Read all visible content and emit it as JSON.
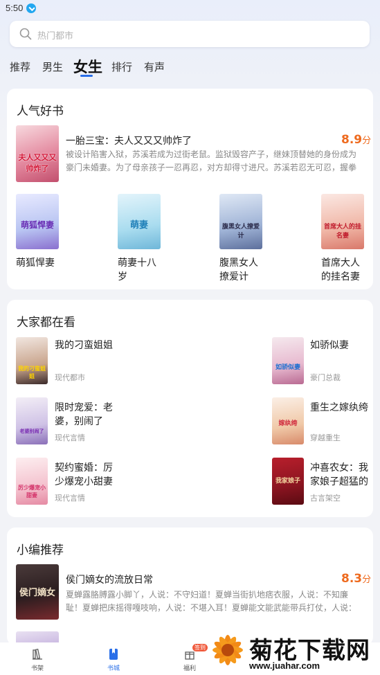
{
  "status_bar": {
    "time": "5:50"
  },
  "search": {
    "placeholder": "热门都市"
  },
  "tabs": [
    {
      "label": "推荐"
    },
    {
      "label": "男生"
    },
    {
      "label": "女生",
      "active": true
    },
    {
      "label": "排行"
    },
    {
      "label": "有声"
    }
  ],
  "popular": {
    "title": "人气好书",
    "featured": {
      "name": "一胎三宝：夫人又又又帅炸了",
      "score": "8.9",
      "score_unit": "分",
      "desc": "被设计陷害入狱，苏溪若成为过街老鼠。监狱毁容产子，继妹顶替她的身份成为豪门未婚妻。为了母亲孩子一忍再忍，对方却得寸进尺。苏溪若忍无可忍，握拳发誓，再忍她就…",
      "cover_text": "夫人又又又帅炸了"
    },
    "books": [
      {
        "name": "萌狐悍妻",
        "cover_text": "萌狐悍妻"
      },
      {
        "name": "萌妻十八岁",
        "cover_text": "萌妻"
      },
      {
        "name": "腹黑女人撩爱计",
        "cover_text": "腹黑女人撩爱计"
      },
      {
        "name": "首席大人的挂名妻",
        "cover_text": "首席大人的挂名妻"
      }
    ]
  },
  "everyone": {
    "title": "大家都在看",
    "books": [
      {
        "name": "我的刁蛮姐姐",
        "tag": "现代都市",
        "cover_text": "我的刁蛮姐姐"
      },
      {
        "name": "如骄似妻",
        "tag": "豪门总裁",
        "cover_text": "如骄似妻"
      },
      {
        "name": "限时宠爱：老婆，别闹了",
        "tag": "现代言情",
        "cover_text": "老婆别闹了"
      },
      {
        "name": "重生之嫁纨绔",
        "tag": "穿越重生",
        "cover_text": "嫁纨绔"
      },
      {
        "name": "契约蜜婚：厉少爆宠小甜妻",
        "tag": "现代言情",
        "cover_text": "厉少爆宠小甜妻"
      },
      {
        "name": "冲喜农女：我家娘子超猛的",
        "tag": "古言架空",
        "cover_text": "我家娘子"
      }
    ]
  },
  "editor": {
    "title": "小编推荐",
    "featured": {
      "name": "侯门嫡女的流放日常",
      "score": "8.3",
      "score_unit": "分",
      "desc": "夏蝉露胳膊露小脚丫，人说：不守妇道！夏蝉当街扒地痞衣服，人说：不知廉耻！夏蝉把床摇得嘎吱响，人说：不堪入耳！夏蝉能文能武能带兵打仗，人说：不伦不类！某…",
      "cover_text": "侯门嫡女"
    }
  },
  "bottom_nav": [
    {
      "label": "书架",
      "icon": "bookshelf-icon"
    },
    {
      "label": "书城",
      "icon": "bookstore-icon",
      "active": true
    },
    {
      "label": "福利",
      "icon": "gift-icon",
      "badge": "签到"
    }
  ],
  "watermark": {
    "title": "菊花下载网",
    "url": "www.juahar.com"
  },
  "colors": {
    "accent": "#2a6fe8",
    "score": "#ee6a1e"
  }
}
